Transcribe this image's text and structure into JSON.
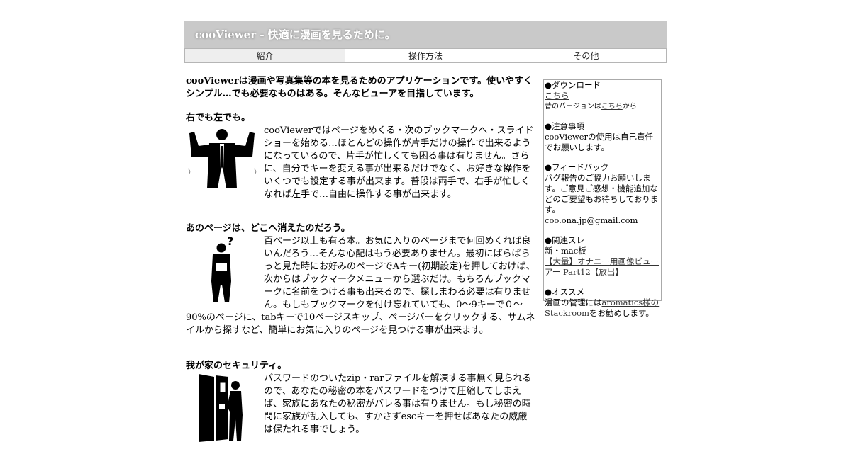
{
  "header": {
    "title": "cooViewer - 快適に漫画を見るために。"
  },
  "tabs": [
    {
      "label": "紹介"
    },
    {
      "label": "操作方法"
    },
    {
      "label": "その他"
    }
  ],
  "intro": "cooViewerは漫画や写真集等の本を見るためのアプリケーションです。使いやすくシンプル…でも必要なものはある。そんなビューアを目指しています。",
  "sections": [
    {
      "heading": "右でも左でも。",
      "icon": "man-arms-raised",
      "body": "cooViewerではページをめくる・次のブックマークへ・スライドショーを始める…ほとんどの操作が片手だけの操作で出来るようになっているので、片手が忙しくても困る事は有りません。さらに、自分でキーを変える事が出来るだけでなく、お好きな操作をいくつでも設定する事が出来ます。普段は両手で、右手が忙しくなれば左手で…自由に操作する事が出来ます。"
    },
    {
      "heading": "あのページは、どこへ消えたのだろう。",
      "icon": "man-question",
      "body": "百ページ以上も有る本。お気に入りのページまで何回めくれば良いんだろう…そんな心配はもう必要ありません。最初にぱらぱらっと見た時にお好みのページでAキー(初期設定)を押しておけば、次からはブックマークメニューから選ぶだけ。もちろんブックマークに名前をつける事も出来るので、探しまわる必要は有りません。もしもブックマークを付け忘れていても、0〜9キーで０〜90%のページに、tabキーで10ページスキップ、ページバーをクリックする、サムネイルから探すなど、簡単にお気に入りのページを見つける事が出来ます。"
    },
    {
      "heading": "我が家のセキュリティ。",
      "icon": "man-door",
      "body": "パスワードのついたzip・rarファイルを解凍する事無く見られるので、あなたの秘密の本をパスワードをつけて圧縮してしまえば、家族にあなたの秘密がバレる事は有りません。もし秘密の時間に家族が乱入しても、すかさずescキーを押せばあなたの威厳は保たれる事でしょう。"
    }
  ],
  "sidebar": {
    "download": {
      "title": "●ダウンロード",
      "link": "こちら",
      "old_prefix": "昔のバージョンは",
      "old_link": "こちら",
      "old_suffix": "から"
    },
    "notice": {
      "title": "●注意事項",
      "text": "cooViewerの使用は自己責任でお願いします。"
    },
    "feedback": {
      "title": "●フィードバック",
      "text": "バグ報告のご協力お願いします。ご意見ご感想・機能追加などのご要望もお待ちしております。",
      "email": "coo.ona.jp@gmail.com"
    },
    "related": {
      "title": "●関連スレ",
      "text": "新・mac板",
      "link": "【大量】オナニー用画像ビューアー Part12【放出】"
    },
    "recommend": {
      "title": "●オススメ",
      "prefix": "漫画の管理には",
      "link": "aromatics様のStackroom",
      "suffix": "をお勧めします。"
    }
  }
}
